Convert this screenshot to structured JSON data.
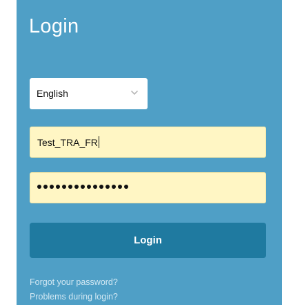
{
  "title": "Login",
  "language": {
    "selected": "English",
    "chevron_icon": "chevron-down-icon"
  },
  "username": {
    "value": "Test_TRA_FR"
  },
  "password": {
    "masked_length": 15
  },
  "login_button": {
    "label": "Login"
  },
  "links": {
    "forgot_password": "Forgot your password?",
    "problems": "Problems during login?"
  },
  "colors": {
    "panel_background": "#4f9fc6",
    "button_background": "#1f7aa0",
    "input_background": "#fff6c4",
    "link_text": "#d2e8f3"
  }
}
